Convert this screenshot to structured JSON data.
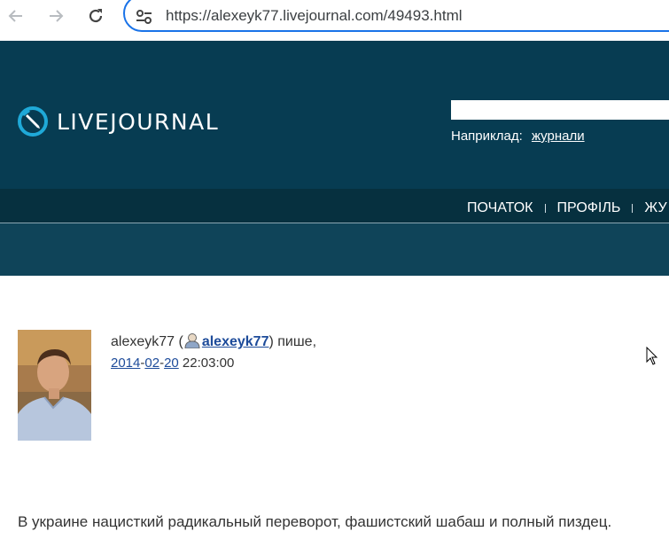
{
  "browser": {
    "url": "https://alexeyk77.livejournal.com/49493.html",
    "icons": {
      "back": "arrow-left-icon",
      "forward": "arrow-right-icon",
      "reload": "reload-icon",
      "site_info": "tune-icon"
    }
  },
  "header": {
    "logo_text": "LIVEJOURNAL",
    "search_placeholder": "",
    "search_hint_label": "Наприклад:",
    "search_hint_link": "журнали"
  },
  "nav": {
    "items": [
      "ПОЧАТОК",
      "ПРОФІЛЬ",
      "ЖУ"
    ]
  },
  "entry": {
    "author_name": "alexeyk77",
    "open_paren": "(",
    "author_link": "alexeyk77",
    "after_link": ") пише,",
    "date_year": "2014",
    "date_month": "02",
    "date_day": "20",
    "time": "22:03:00",
    "text": "В украине нацисткий радикальный переворот, фашистский шабаш и полный пиздец."
  },
  "colors": {
    "header_bg": "#073c52",
    "nav_bg": "#06303f",
    "subbar_bg": "#0f4459",
    "link": "#1d4b9a",
    "url_focus": "#1a73e8"
  }
}
